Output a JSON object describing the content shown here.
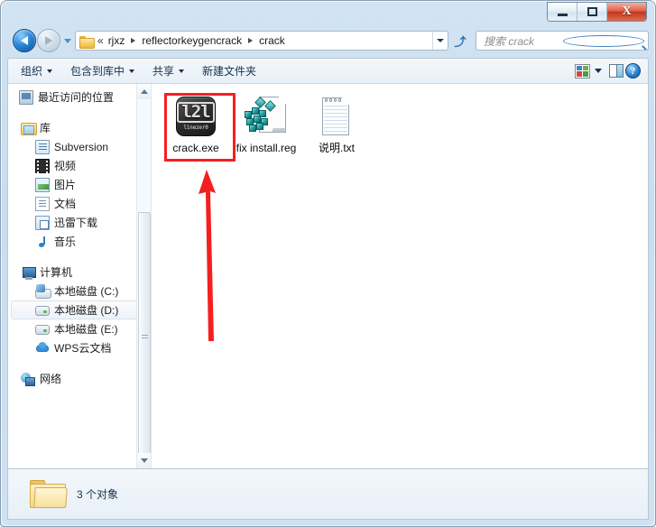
{
  "window": {
    "controls": {
      "minimize": "–",
      "maximize": "□",
      "close": "X"
    }
  },
  "address": {
    "back_icon": "back-arrow",
    "forward_icon": "forward-arrow",
    "history_icon": "history-dropdown",
    "folder_icon": "folder-icon",
    "chevrons": "«",
    "crumbs": [
      "rjxz",
      "reflectorkeygencrack",
      "crack"
    ],
    "dropdown_icon": "chevron-down-icon",
    "refresh_icon": "↻",
    "refresh_glyph": "⤴"
  },
  "search": {
    "placeholder": "搜索 crack",
    "icon": "search-icon"
  },
  "toolbar": {
    "organize": "组织",
    "include_in_library": "包含到库中",
    "share": "共享",
    "new_folder": "新建文件夹",
    "views_icon": "view-options-icon",
    "pane_icon": "preview-pane-icon",
    "help_icon": "help-icon",
    "help_glyph": "?"
  },
  "sidebar": {
    "items": [
      {
        "label": "最近访问的位置",
        "icon": "recent-places-icon",
        "indent": false,
        "selected": false
      },
      {
        "label": "库",
        "icon": "library-icon",
        "indent": false,
        "selected": false
      },
      {
        "label": "Subversion",
        "icon": "subversion-icon",
        "indent": true,
        "selected": false
      },
      {
        "label": "视频",
        "icon": "videos-icon",
        "indent": true,
        "selected": false
      },
      {
        "label": "图片",
        "icon": "pictures-icon",
        "indent": true,
        "selected": false
      },
      {
        "label": "文档",
        "icon": "documents-icon",
        "indent": true,
        "selected": false
      },
      {
        "label": "迅雷下载",
        "icon": "thunder-download-icon",
        "indent": true,
        "selected": false
      },
      {
        "label": "音乐",
        "icon": "music-icon",
        "indent": true,
        "selected": false
      },
      {
        "label": "计算机",
        "icon": "computer-icon",
        "indent": false,
        "selected": false
      },
      {
        "label": "本地磁盘 (C:)",
        "icon": "system-drive-icon",
        "indent": true,
        "selected": false
      },
      {
        "label": "本地磁盘 (D:)",
        "icon": "drive-icon",
        "indent": true,
        "selected": true
      },
      {
        "label": "本地磁盘 (E:)",
        "icon": "drive-icon",
        "indent": true,
        "selected": false
      },
      {
        "label": "WPS云文档",
        "icon": "wps-cloud-icon",
        "indent": true,
        "selected": false
      },
      {
        "label": "网络",
        "icon": "network-icon",
        "indent": false,
        "selected": false
      }
    ]
  },
  "files": [
    {
      "name": "crack.exe",
      "icon": "exe-file-icon",
      "icon_text": "l2l",
      "icon_subtext": "linezer0",
      "highlighted": true
    },
    {
      "name": "fix install.reg",
      "icon": "registry-file-icon",
      "highlighted": false
    },
    {
      "name": "说明.txt",
      "icon": "text-file-icon",
      "highlighted": false
    }
  ],
  "annotation": {
    "arrow_color": "#f42020",
    "box_color": "#f42020",
    "arrow_direction": "up",
    "target": "crack.exe"
  },
  "status": {
    "count_text": "3 个对象",
    "folder_icon": "folder-icon"
  },
  "colors": {
    "accent": "#2f83cf",
    "annotation_red": "#f42020",
    "frame": "#cfe2f2",
    "close_red": "#c5351e"
  }
}
